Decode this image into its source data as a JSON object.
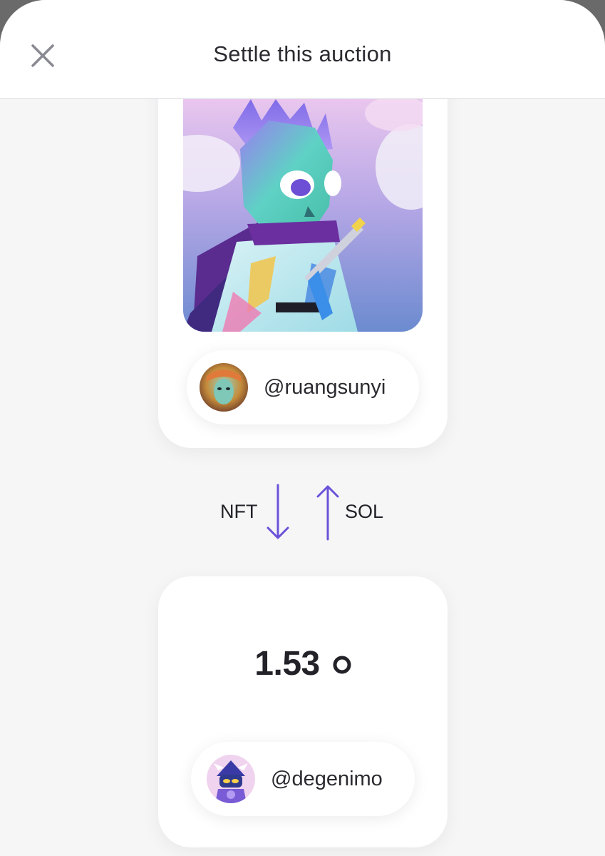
{
  "header": {
    "title": "Settle this auction",
    "close_icon": "close-icon"
  },
  "nft_card": {
    "image": "nft-artwork-skeleton-samurai",
    "owner_handle": "@ruangsunyi",
    "owner_avatar": "avatar-ruangsunyi"
  },
  "swap": {
    "left_label": "NFT",
    "left_icon": "arrow-down-icon",
    "right_label": "SOL",
    "right_icon": "arrow-up-icon",
    "accent_color": "#6c52d9"
  },
  "bid_card": {
    "amount": "1.53",
    "currency_icon": "sol-coin-icon",
    "bidder_handle": "@degenimo",
    "bidder_avatar": "avatar-degenimo"
  }
}
